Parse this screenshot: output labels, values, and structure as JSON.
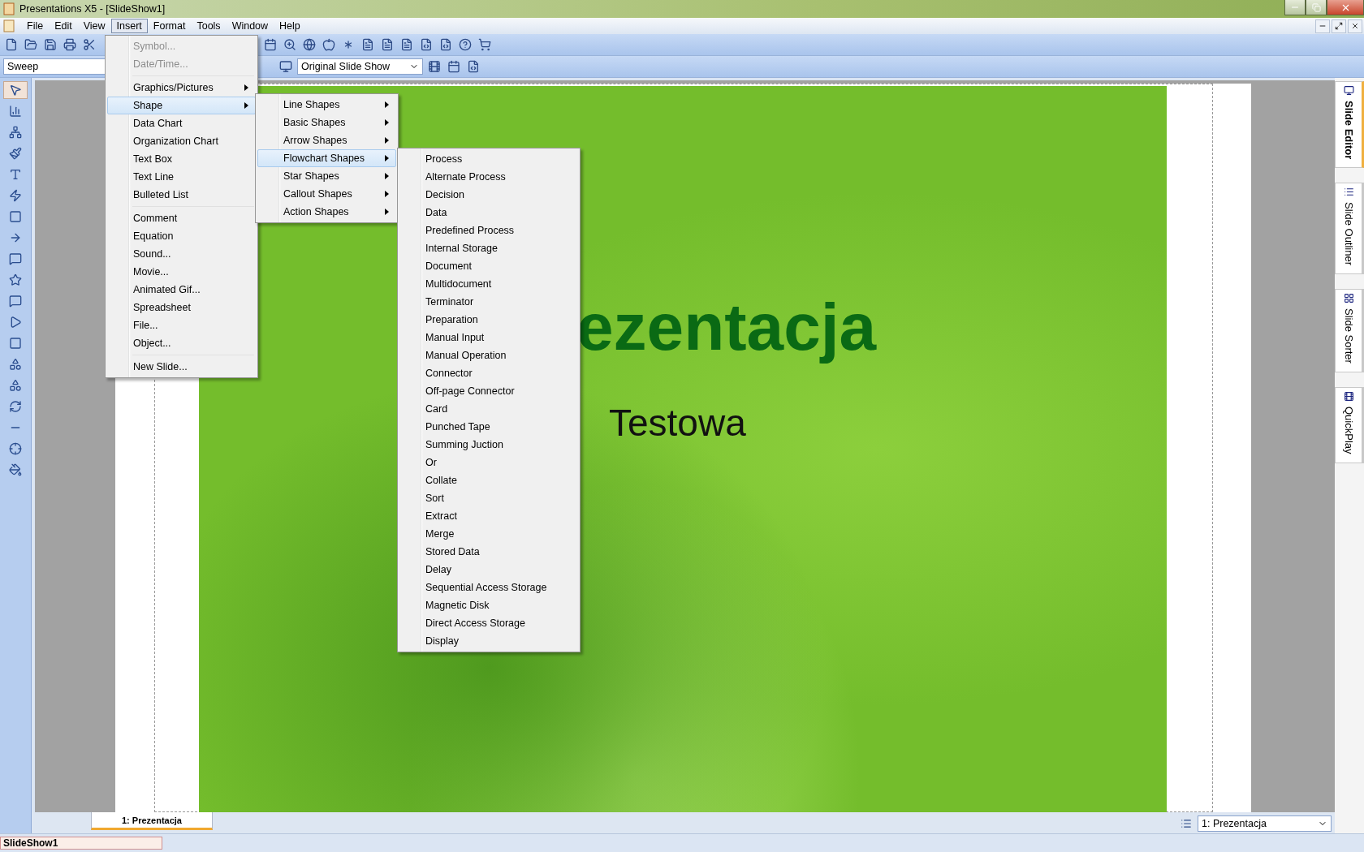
{
  "window": {
    "title": "Presentations X5 - [SlideShow1]"
  },
  "menu_bar": [
    {
      "label": "File",
      "selected": false
    },
    {
      "label": "Edit",
      "selected": false
    },
    {
      "label": "View",
      "selected": false
    },
    {
      "label": "Insert",
      "selected": true
    },
    {
      "label": "Format",
      "selected": false
    },
    {
      "label": "Tools",
      "selected": false
    },
    {
      "label": "Window",
      "selected": false
    },
    {
      "label": "Help",
      "selected": false
    }
  ],
  "toolbar": {
    "style_field": {
      "value": "Sweep"
    },
    "show_select": {
      "value": "Original Slide Show"
    }
  },
  "insert_menu": [
    {
      "kind": "item",
      "label": "Symbol...",
      "disabled": true,
      "submenu": false,
      "selected": false
    },
    {
      "kind": "item",
      "label": "Date/Time...",
      "disabled": true,
      "submenu": false,
      "selected": false
    },
    {
      "kind": "separator"
    },
    {
      "kind": "item",
      "label": "Graphics/Pictures",
      "disabled": false,
      "submenu": true,
      "selected": false
    },
    {
      "kind": "item",
      "label": "Shape",
      "disabled": false,
      "submenu": true,
      "selected": true
    },
    {
      "kind": "item",
      "label": "Data Chart",
      "disabled": false,
      "submenu": false,
      "selected": false
    },
    {
      "kind": "item",
      "label": "Organization Chart",
      "disabled": false,
      "submenu": false,
      "selected": false
    },
    {
      "kind": "item",
      "label": "Text Box",
      "disabled": false,
      "submenu": false,
      "selected": false
    },
    {
      "kind": "item",
      "label": "Text Line",
      "disabled": false,
      "submenu": false,
      "selected": false
    },
    {
      "kind": "item",
      "label": "Bulleted List",
      "disabled": false,
      "submenu": false,
      "selected": false
    },
    {
      "kind": "separator"
    },
    {
      "kind": "item",
      "label": "Comment",
      "disabled": false,
      "submenu": false,
      "selected": false
    },
    {
      "kind": "item",
      "label": "Equation",
      "disabled": false,
      "submenu": false,
      "selected": false
    },
    {
      "kind": "item",
      "label": "Sound...",
      "disabled": false,
      "submenu": false,
      "selected": false
    },
    {
      "kind": "item",
      "label": "Movie...",
      "disabled": false,
      "submenu": false,
      "selected": false
    },
    {
      "kind": "item",
      "label": "Animated Gif...",
      "disabled": false,
      "submenu": false,
      "selected": false
    },
    {
      "kind": "item",
      "label": "Spreadsheet",
      "disabled": false,
      "submenu": false,
      "selected": false
    },
    {
      "kind": "item",
      "label": "File...",
      "disabled": false,
      "submenu": false,
      "selected": false
    },
    {
      "kind": "item",
      "label": "Object...",
      "disabled": false,
      "submenu": false,
      "selected": false
    },
    {
      "kind": "separator"
    },
    {
      "kind": "item",
      "label": "New Slide...",
      "disabled": false,
      "submenu": false,
      "selected": false
    }
  ],
  "shape_menu": [
    {
      "label": "Line Shapes",
      "selected": false
    },
    {
      "label": "Basic Shapes",
      "selected": false
    },
    {
      "label": "Arrow Shapes",
      "selected": false
    },
    {
      "label": "Flowchart Shapes",
      "selected": true
    },
    {
      "label": "Star Shapes",
      "selected": false
    },
    {
      "label": "Callout Shapes",
      "selected": false
    },
    {
      "label": "Action Shapes",
      "selected": false
    }
  ],
  "flowchart_menu": [
    "Process",
    "Alternate Process",
    "Decision",
    "Data",
    "Predefined Process",
    "Internal Storage",
    "Document",
    "Multidocument",
    "Terminator",
    "Preparation",
    "Manual Input",
    "Manual Operation",
    "Connector",
    "Off-page Connector",
    "Card",
    "Punched Tape",
    "Summing Juction",
    "Or",
    "Collate",
    "Sort",
    "Extract",
    "Merge",
    "Stored Data",
    "Delay",
    "Sequential Access Storage",
    "Magnetic Disk",
    "Direct Access Storage",
    "Display"
  ],
  "slide": {
    "title": "ezentacja",
    "subtitle": "Testowa"
  },
  "view_tabs": [
    {
      "label": "Slide Editor",
      "selected": true
    },
    {
      "label": "Slide Outliner",
      "selected": false
    },
    {
      "label": "Slide Sorter",
      "selected": false
    },
    {
      "label": "QuickPlay",
      "selected": false
    }
  ],
  "slide_tabs": [
    {
      "label": "1: Prezentacja",
      "selected": true
    }
  ],
  "slide_select": {
    "value": "1: Prezentacja"
  },
  "status_bar": {
    "text": "SlideShow1"
  }
}
